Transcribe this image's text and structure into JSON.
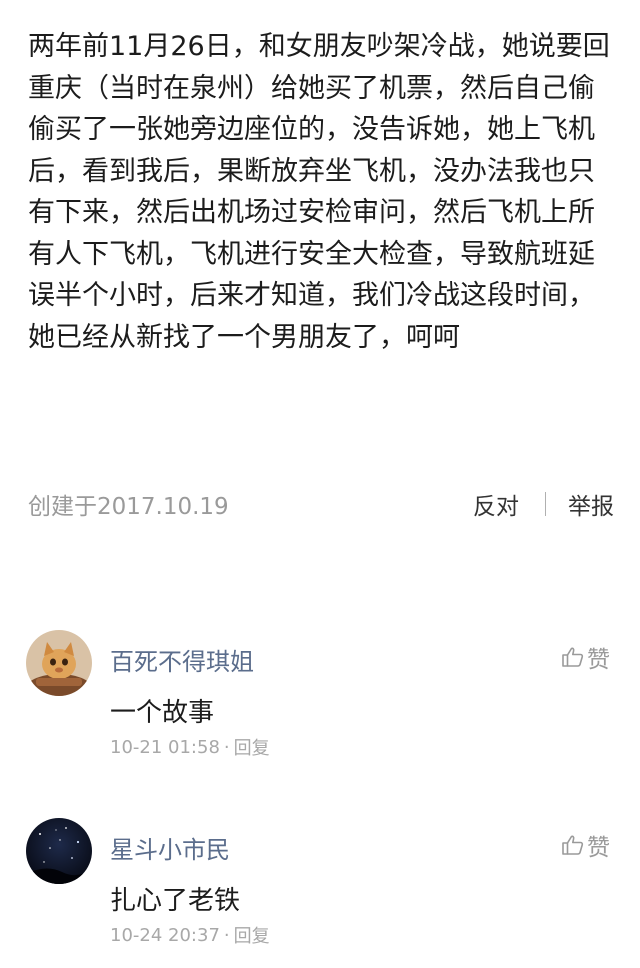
{
  "answer": {
    "text": "两年前11月26日，和女朋友吵架冷战，她说要回重庆（当时在泉州）给她买了机票，然后自己偷偷买了一张她旁边座位的，没告诉她，她上飞机后，看到我后，果断放弃坐飞机，没办法我也只有下来，然后出机场过安检审问，然后飞机上所有人下飞机，飞机进行安全大检查，导致航班延误半个小时，后来才知道，我们冷战这段时间，她已经从新找了一个男朋友了，呵呵",
    "created": "创建于2017.10.19",
    "oppose_label": "反对",
    "report_label": "举报"
  },
  "comments": [
    {
      "name": "百死不得琪姐",
      "text": "一个故事",
      "time": "10-21 01:58",
      "dot": "·",
      "reply_label": "回复",
      "like_label": "赞",
      "avatar_icon": "cat-avatar"
    },
    {
      "name": "星斗小市民",
      "text": "扎心了老铁",
      "time": "10-24 20:37",
      "dot": "·",
      "reply_label": "回复",
      "like_label": "赞",
      "avatar_icon": "night-sky-avatar"
    }
  ],
  "colors": {
    "username": "#5b6d8c",
    "meta_gray": "#9a9a9a",
    "body_text": "#1c1c1c"
  }
}
